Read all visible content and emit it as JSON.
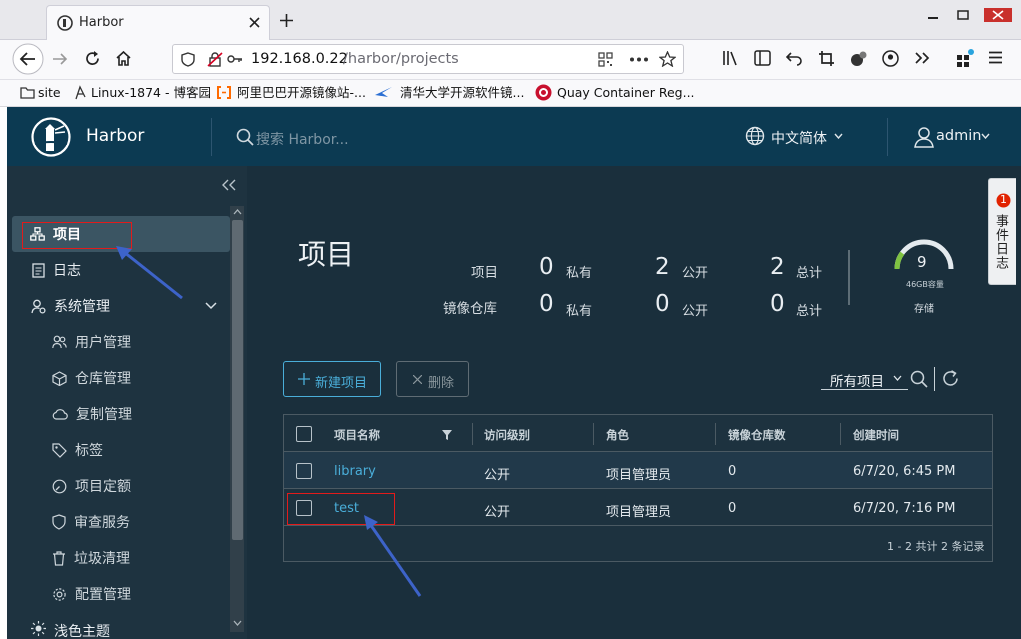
{
  "browser": {
    "tab_title": "Harbor",
    "url_host": "192.168.0.22",
    "url_path": "/harbor/projects",
    "bookmarks": [
      "site",
      "Linux-1874 - 博客园",
      "阿里巴巴开源镜像站-...",
      "清华大学开源软件镜...",
      "Quay Container Reg..."
    ]
  },
  "header": {
    "app_name": "Harbor",
    "search_placeholder": "搜索 Harbor...",
    "language": "中文简体",
    "user": "admin"
  },
  "sidebar": {
    "items": [
      {
        "label": "项目",
        "icon": "projects-icon",
        "active": true
      },
      {
        "label": "日志",
        "icon": "log-icon"
      },
      {
        "label": "系统管理",
        "icon": "admin-icon"
      }
    ],
    "sub_items": [
      {
        "label": "用户管理",
        "icon": "users-icon"
      },
      {
        "label": "仓库管理",
        "icon": "registry-icon"
      },
      {
        "label": "复制管理",
        "icon": "replication-icon"
      },
      {
        "label": "标签",
        "icon": "tag-icon"
      },
      {
        "label": "项目定额",
        "icon": "quota-icon"
      },
      {
        "label": "审查服务",
        "icon": "shield-icon"
      },
      {
        "label": "垃圾清理",
        "icon": "trash-icon"
      },
      {
        "label": "配置管理",
        "icon": "gear-icon"
      }
    ],
    "partial_item": "浅色主题"
  },
  "main": {
    "title": "项目",
    "stats": {
      "projects_label": "项目",
      "repos_label": "镜像仓库",
      "private_label": "私有",
      "public_label": "公开",
      "total_label": "总计",
      "projects_private": "0",
      "projects_public": "2",
      "projects_total": "2",
      "repos_private": "0",
      "repos_public": "0",
      "repos_total": "0"
    },
    "storage": {
      "value": "9",
      "capacity": "46GB容量",
      "label": "存储",
      "fraction": 0.2
    },
    "event_log_tab": "事件日志",
    "event_badge": "1",
    "new_project_button": "新建项目",
    "delete_button": "删除",
    "filter_select": "所有项目",
    "columns": [
      "项目名称",
      "访问级别",
      "角色",
      "镜像仓库数",
      "创建时间"
    ],
    "rows": [
      {
        "name": "library",
        "access": "公开",
        "role": "项目管理员",
        "repos": "0",
        "created": "6/7/20, 6:45 PM"
      },
      {
        "name": "test",
        "access": "公开",
        "role": "项目管理员",
        "repos": "0",
        "created": "6/7/20, 7:16 PM"
      }
    ],
    "footer": "1 - 2 共计 2 条记录"
  },
  "colors": {
    "header_bg": "#0c3a52",
    "sidebar_bg": "#1e3340",
    "main_bg": "#1a2f3c",
    "link": "#4aaed9",
    "annotation_red": "#e21b1b",
    "annotation_arrow": "#3d63c9"
  }
}
